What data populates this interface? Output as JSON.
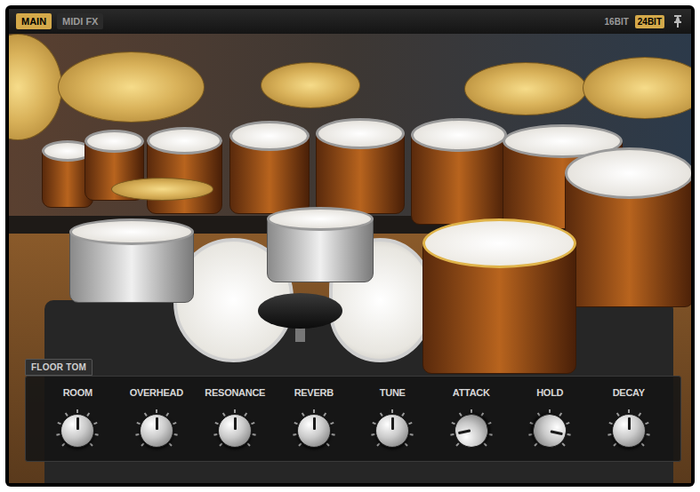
{
  "tabs": [
    {
      "label": "MAIN",
      "selected": true
    },
    {
      "label": "MIDI FX",
      "selected": false
    }
  ],
  "bit_depth": [
    {
      "label": "16BIT",
      "selected": false
    },
    {
      "label": "24BIT",
      "selected": true
    }
  ],
  "kit": {
    "pieces": [
      {
        "kind": "cymbal",
        "selected": false
      },
      {
        "kind": "cymbal",
        "selected": false
      },
      {
        "kind": "cymbal",
        "selected": false
      },
      {
        "kind": "cymbal",
        "selected": false
      },
      {
        "kind": "cymbal",
        "selected": false
      },
      {
        "kind": "tom",
        "selected": false
      },
      {
        "kind": "tom",
        "selected": false
      },
      {
        "kind": "tom",
        "selected": false
      },
      {
        "kind": "tom",
        "selected": false
      },
      {
        "kind": "tom",
        "selected": false
      },
      {
        "kind": "tom",
        "selected": false
      },
      {
        "kind": "tom",
        "selected": false
      },
      {
        "kind": "cymbal",
        "selected": false
      },
      {
        "kind": "tom",
        "selected": false
      },
      {
        "kind": "kick",
        "selected": false
      },
      {
        "kind": "kick",
        "selected": false
      },
      {
        "kind": "snare",
        "selected": false
      },
      {
        "kind": "snare",
        "selected": false
      },
      {
        "kind": "tom",
        "selected": true
      },
      {
        "kind": "seat",
        "selected": false
      }
    ]
  },
  "panel": {
    "title": "FLOOR TOM",
    "knobs": [
      {
        "label": "ROOM",
        "level": 0.5
      },
      {
        "label": "OVERHEAD",
        "level": 0.5
      },
      {
        "label": "RESONANCE",
        "level": 0.5
      },
      {
        "label": "REVERB",
        "level": 0.5
      },
      {
        "label": "TUNE",
        "level": 0.5
      },
      {
        "label": "ATTACK",
        "level": 0.12
      },
      {
        "label": "HOLD",
        "level": 0.88
      },
      {
        "label": "DECAY",
        "level": 0.5
      }
    ]
  }
}
